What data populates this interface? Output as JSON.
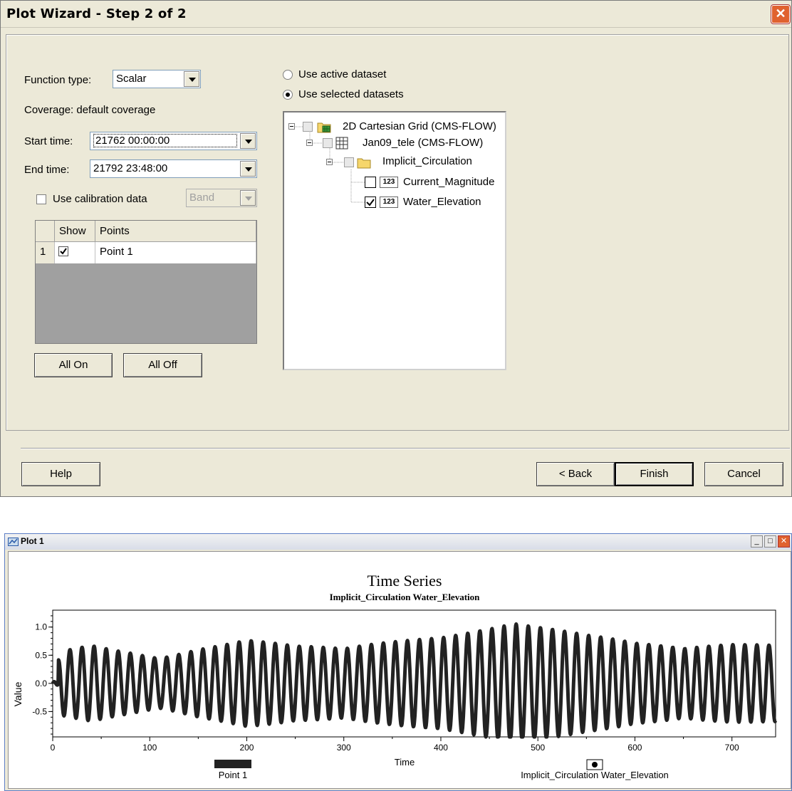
{
  "dialog": {
    "title": "Plot Wizard - Step 2 of 2",
    "close_label": "✕",
    "function_type_label": "Function type:",
    "function_type_value": "Scalar",
    "coverage_text": "Coverage: default coverage",
    "start_time_label": "Start time:",
    "start_time_value": "21762 00:00:00",
    "end_time_label": "End time:",
    "end_time_value": "21792 23:48:00",
    "use_calibration_label": "Use calibration data",
    "calibration_mode_value": "Band",
    "points_table": {
      "columns": [
        "Show",
        "Points"
      ],
      "rows": [
        {
          "index": "1",
          "show": true,
          "name": "Point 1"
        }
      ]
    },
    "all_on_label": "All On",
    "all_off_label": "All Off",
    "use_active_dataset_label": "Use active dataset",
    "use_selected_datasets_label": "Use selected datasets",
    "tree": {
      "grid": "2D Cartesian Grid (CMS-FLOW)",
      "mesh": "Jan09_tele (CMS-FLOW)",
      "folder": "Implicit_Circulation",
      "dataset_badge": "123",
      "datasets": [
        {
          "name": "Current_Magnitude",
          "checked": false
        },
        {
          "name": "Water_Elevation",
          "checked": true
        }
      ]
    },
    "help_label": "Help",
    "back_label": "< Back",
    "finish_label": "Finish",
    "cancel_label": "Cancel"
  },
  "plot_window": {
    "title": "Plot 1",
    "minimize_label": "_",
    "maximize_label": "□",
    "close_label": "✕"
  },
  "chart_data": {
    "type": "line",
    "title": "Time Series",
    "subtitle": "Implicit_Circulation Water_Elevation",
    "xlabel": "Time",
    "ylabel": "Value",
    "xlim": [
      0,
      745
    ],
    "ylim": [
      -0.95,
      1.3
    ],
    "x_ticks": [
      "0",
      "100",
      "200",
      "300",
      "400",
      "500",
      "600",
      "700"
    ],
    "y_ticks": [
      "-0.5",
      "0.0",
      "0.5",
      "1.0"
    ],
    "series": [
      {
        "name": "Point 1",
        "color": "#222222",
        "period_hours": 12.42,
        "x_start": 0,
        "x_end": 745,
        "mean": 0.0,
        "amplitude_envelope": [
          [
            0,
            0.05
          ],
          [
            8,
            0.55
          ],
          [
            40,
            0.7
          ],
          [
            80,
            0.6
          ],
          [
            110,
            0.5
          ],
          [
            150,
            0.65
          ],
          [
            200,
            0.75
          ],
          [
            250,
            0.6
          ],
          [
            300,
            0.55
          ],
          [
            350,
            0.7
          ],
          [
            400,
            0.85
          ],
          [
            440,
            1.05
          ],
          [
            475,
            1.2
          ],
          [
            510,
            1.05
          ],
          [
            550,
            0.85
          ],
          [
            600,
            0.65
          ],
          [
            650,
            0.55
          ],
          [
            700,
            0.65
          ],
          [
            745,
            0.7
          ]
        ]
      }
    ],
    "legend": [
      "Point 1",
      "Implicit_Circulation Water_Elevation"
    ],
    "grid": false
  }
}
